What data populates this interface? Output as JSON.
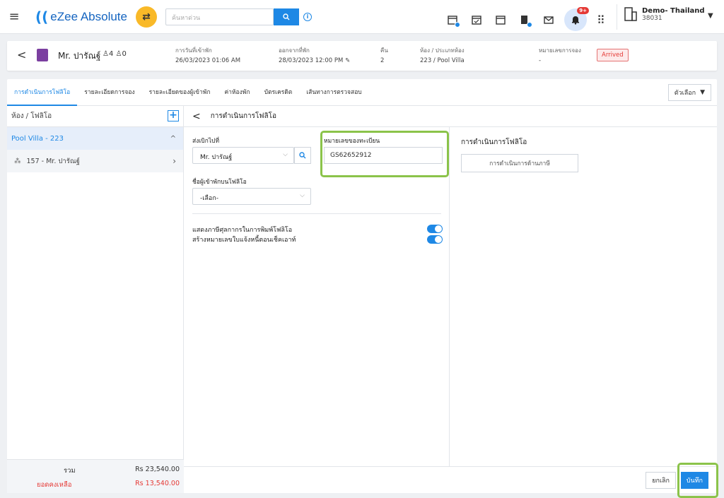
{
  "app": {
    "name": "eZee Absolute",
    "search_placeholder": "ค้นหาด่วน",
    "notification_badge": "9+",
    "hotel_name": "Demo- Thailand",
    "hotel_id": "38031"
  },
  "reservation": {
    "guest_name": "Mr. ปารัณฐ์",
    "adults": "4",
    "children": "0",
    "arrival_label": "การวันที่เข้าพัก",
    "arrival_value": "26/03/2023 01:06 AM",
    "departure_label": "ออกจากที่พัก",
    "departure_value": "28/03/2023 12:00 PM",
    "nights_label": "คืน",
    "nights_value": "2",
    "room_label": "ห้อง / ประเภทห้อง",
    "room_value": "223 / Pool Villa",
    "booking_no_label": "หมายเลขการจอง",
    "booking_no_value": "-",
    "status": "Arrived"
  },
  "tabs": [
    {
      "label": "การดำเนินการโฟลิโอ"
    },
    {
      "label": "รายละเอียดการจอง"
    },
    {
      "label": "รายละเอียดของผู้เข้าพัก"
    },
    {
      "label": "ค่าห้องพัก"
    },
    {
      "label": "บัตรเครดิต"
    },
    {
      "label": "เส้นทางการตรวจสอบ"
    }
  ],
  "options_label": "ตัวเลือก",
  "left_panel": {
    "header": "ห้อง / โฟลิโอ",
    "room": "Pool Villa - 223",
    "folio": "157 - Mr. ปารัณฐ์",
    "total_label": "รวม",
    "total_value": "Rs 23,540.00",
    "balance_label": "ยอดคงเหลือ",
    "balance_value": "Rs 13,540.00"
  },
  "form": {
    "title": "การดำเนินการโฟลิโอ",
    "transfer_to_label": "ส่งเบิกไปที่",
    "transfer_to_value": "Mr. ปารัณฐ์",
    "registration_label": "หมายเลขของทะเบียน",
    "registration_value": "GS62652912",
    "folio_guest_label": "ชื่อผู้เข้าพักบนโฟลิโอ",
    "folio_guest_value": "-เลือก-",
    "toggle1_label": "แสดงภาษีศุลกากรในการพิมพ์โฟลิโอ",
    "toggle2_label": "สร้างหมายเลขใบแจ้งหนี้ตอนเช็คเอาท์",
    "right_title": "การดำเนินการโฟลิโอ",
    "tax_button": "การดำเนินการด้านภาษี",
    "cancel_label": "ยกเลิก",
    "save_label": "บันทึก"
  },
  "colors": {
    "primary": "#1e88e5",
    "highlight": "#8bc34a",
    "status_red": "#e53935",
    "accent_yellow": "#f9b928"
  }
}
